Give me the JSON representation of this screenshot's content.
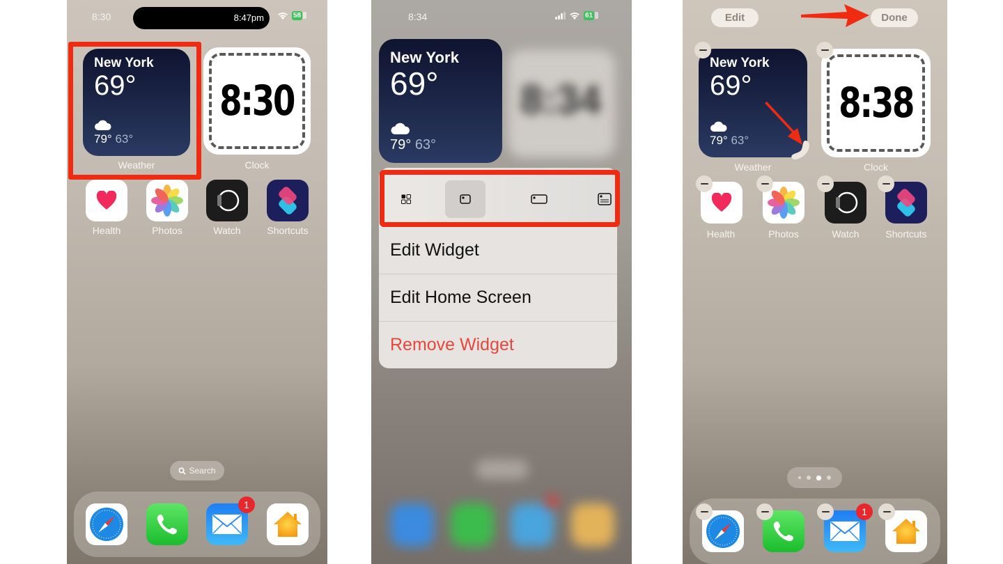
{
  "panels": [
    {
      "status": {
        "time": "8:30",
        "island_text": "8:47pm",
        "battery": "58"
      },
      "weather": {
        "city": "New York",
        "temp": "69°",
        "high": "79°",
        "low": "63°",
        "label": "Weather"
      },
      "clock": {
        "time": "8:30",
        "label": "Clock"
      },
      "apps": [
        {
          "label": "Health"
        },
        {
          "label": "Photos"
        },
        {
          "label": "Watch"
        },
        {
          "label": "Shortcuts"
        }
      ],
      "search_label": "Search",
      "dock": [
        {
          "name": "Safari"
        },
        {
          "name": "Phone"
        },
        {
          "name": "Mail",
          "badge": "1"
        },
        {
          "name": "Home"
        }
      ],
      "highlight_color": "#ef2b12"
    },
    {
      "status": {
        "time": "8:34",
        "battery": "61"
      },
      "weather": {
        "city": "New York",
        "temp": "69°",
        "high": "79°",
        "low": "63°"
      },
      "clock": {
        "time": "8:34"
      },
      "menu": {
        "sizes": [
          {
            "name": "small-grid",
            "selected": false
          },
          {
            "name": "small",
            "selected": true
          },
          {
            "name": "medium",
            "selected": false
          },
          {
            "name": "large",
            "selected": false
          }
        ],
        "items": [
          {
            "label": "Edit Widget"
          },
          {
            "label": "Edit Home Screen"
          },
          {
            "label": "Remove Widget",
            "destructive": true
          }
        ]
      }
    },
    {
      "toolbar": {
        "edit_label": "Edit",
        "done_label": "Done"
      },
      "weather": {
        "city": "New York",
        "temp": "69°",
        "high": "79°",
        "low": "63°",
        "label": "Weather"
      },
      "clock": {
        "time": "8:38",
        "label": "Clock"
      },
      "apps": [
        {
          "label": "Health"
        },
        {
          "label": "Photos"
        },
        {
          "label": "Watch"
        },
        {
          "label": "Shortcuts"
        }
      ],
      "page_dots": {
        "count": 4,
        "active_index": 2
      },
      "dock": [
        {
          "name": "Safari"
        },
        {
          "name": "Phone"
        },
        {
          "name": "Mail",
          "badge": "1"
        },
        {
          "name": "Home"
        }
      ],
      "arrow_color": "#ef2b12"
    }
  ]
}
